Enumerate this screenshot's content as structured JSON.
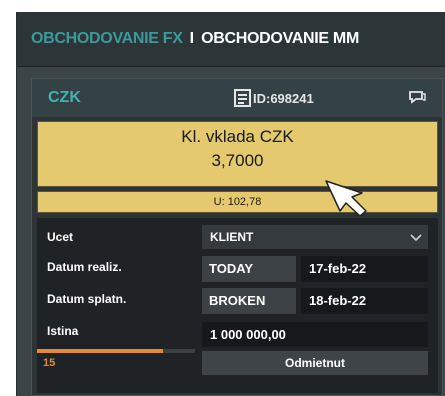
{
  "tabs": {
    "fx": "OBCHODOVANIE FX",
    "separator": "I",
    "mm": "OBCHODOVANIE MM"
  },
  "ticket": {
    "currency": "CZK",
    "id": "ID:698241",
    "rate_label": "Kl. vklada CZK",
    "rate_value": "3,7000",
    "u_value": "U: 102,78"
  },
  "form": {
    "account_label": "Ucet",
    "account_value": "KLIENT",
    "realization_label": "Datum realiz.",
    "realization_tag": "TODAY",
    "realization_date": "17-feb-22",
    "maturity_label": "Datum splatn.",
    "maturity_tag": "BROKEN",
    "maturity_date": "18-feb-22",
    "principal_label": "Istina",
    "principal_value": "1 000 000,00",
    "timer_value": "15",
    "timer_progress": 0.8,
    "reject_label": "Odmietnut"
  },
  "colors": {
    "accent_teal": "#43b3b0",
    "quote_yellow": "#e5c96e",
    "timer_orange": "#e9892c"
  },
  "icons": [
    "document-icon",
    "chat-icon",
    "chevron-down-icon",
    "mouse-cursor-icon"
  ]
}
